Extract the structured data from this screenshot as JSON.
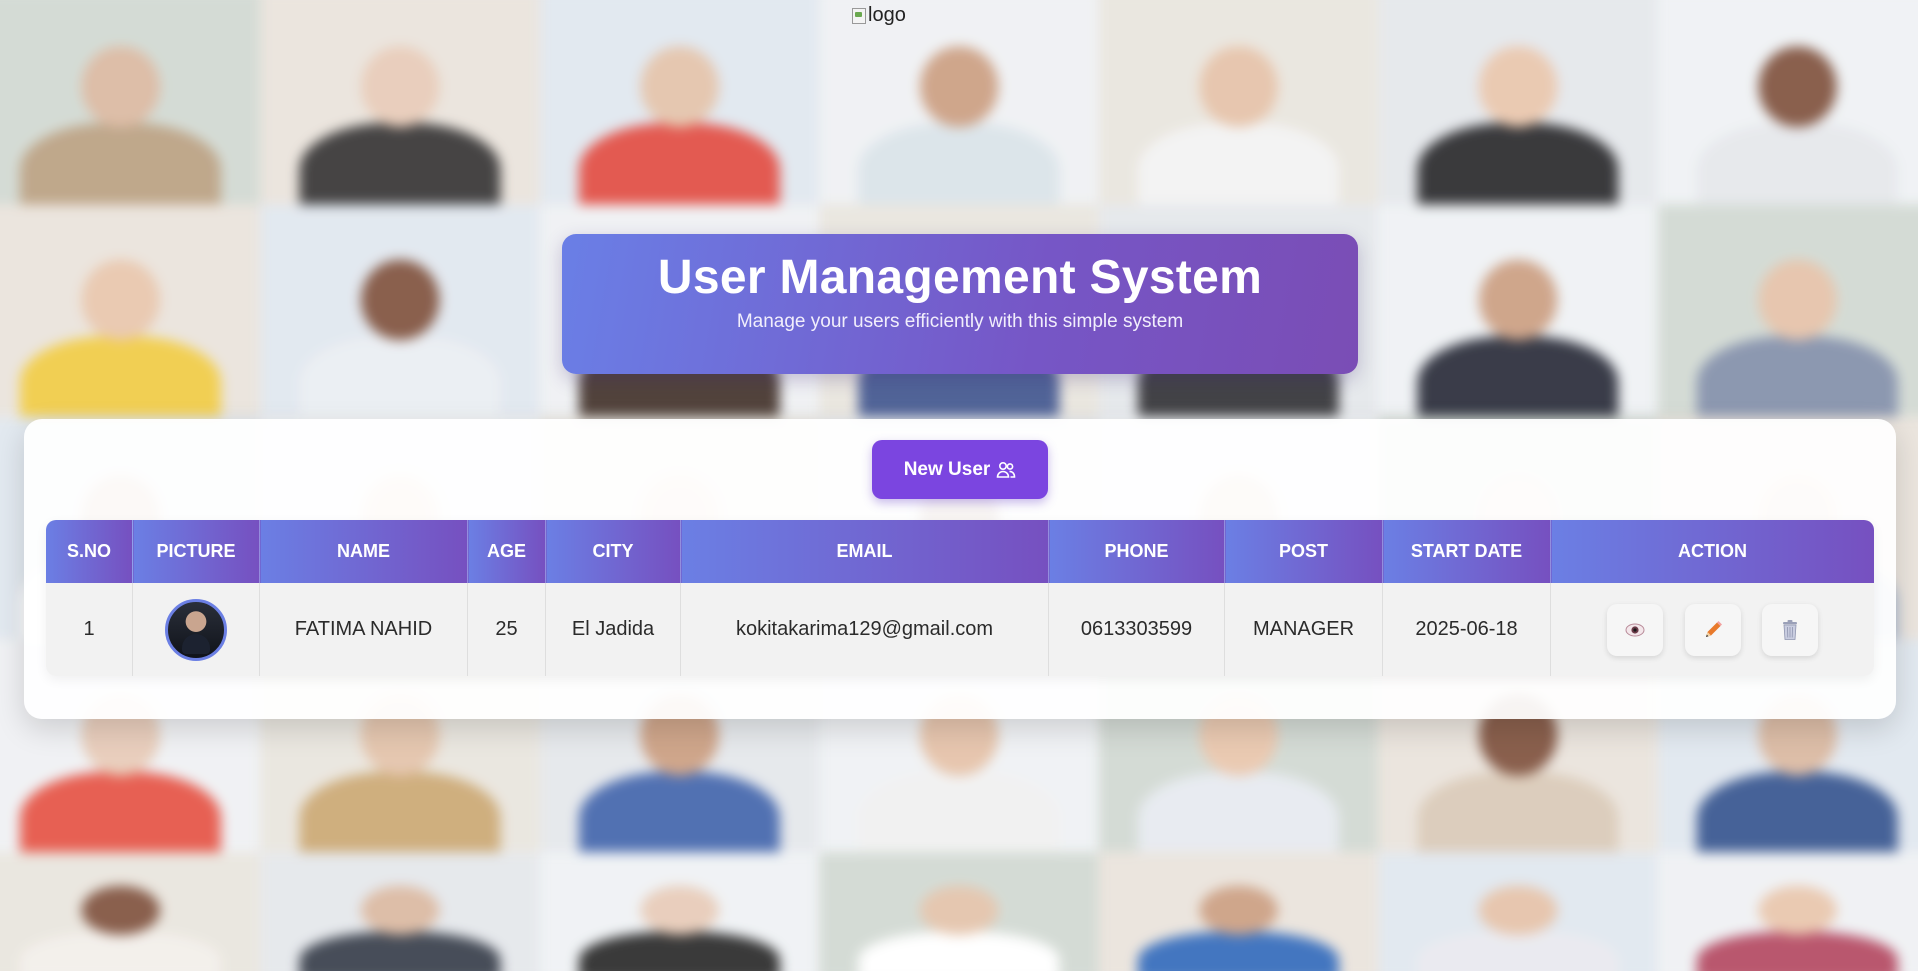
{
  "logo": {
    "alt_text": "logo"
  },
  "header": {
    "title": "User Management System",
    "subtitle": "Manage your users efficiently with this simple system"
  },
  "toolbar": {
    "new_user_label": "New User",
    "new_user_icon": "users-icon"
  },
  "table": {
    "columns": [
      "S.NO",
      "PICTURE",
      "NAME",
      "AGE",
      "CITY",
      "EMAIL",
      "PHONE",
      "POST",
      "START DATE",
      "ACTION"
    ],
    "rows": [
      {
        "sno": "1",
        "name": "FATIMA NAHID",
        "age": "25",
        "city": "El Jadida",
        "email": "kokitakarima129@gmail.com",
        "phone": "0613303599",
        "post": "MANAGER",
        "start_date": "2025-06-18",
        "actions": [
          {
            "name": "view",
            "icon": "eye-icon",
            "glyph": "👁"
          },
          {
            "name": "edit",
            "icon": "pencil-icon",
            "glyph": "✏"
          },
          {
            "name": "delete",
            "icon": "trash-icon",
            "glyph": "🗑"
          }
        ]
      }
    ]
  },
  "colors": {
    "accent": "#7b45e0",
    "header_gradient_start": "#6a7fe6",
    "header_gradient_end": "#7a4db5",
    "edit_icon": "#e87a2c"
  }
}
